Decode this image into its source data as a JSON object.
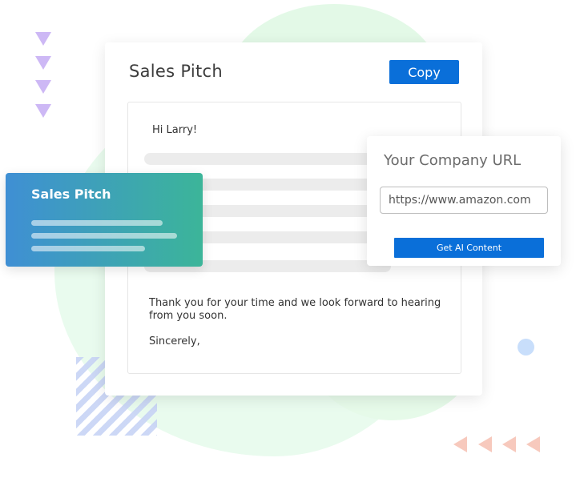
{
  "main_card": {
    "title": "Sales Pitch",
    "copy_label": "Copy",
    "email": {
      "greeting": "Hi Larry!",
      "closing": "Thank you for your time and we look forward to hearing from you soon.",
      "signoff": "Sincerely,"
    }
  },
  "gradient_card": {
    "title": "Sales Pitch"
  },
  "url_card": {
    "title": "Your Company URL",
    "input_value": "https://www.amazon.com",
    "button_label": "Get AI Content"
  },
  "colors": {
    "accent": "#0a6fd9",
    "gradient_start": "#3f8fd4",
    "gradient_end": "#3cb599",
    "blob": "#e9fbee"
  }
}
